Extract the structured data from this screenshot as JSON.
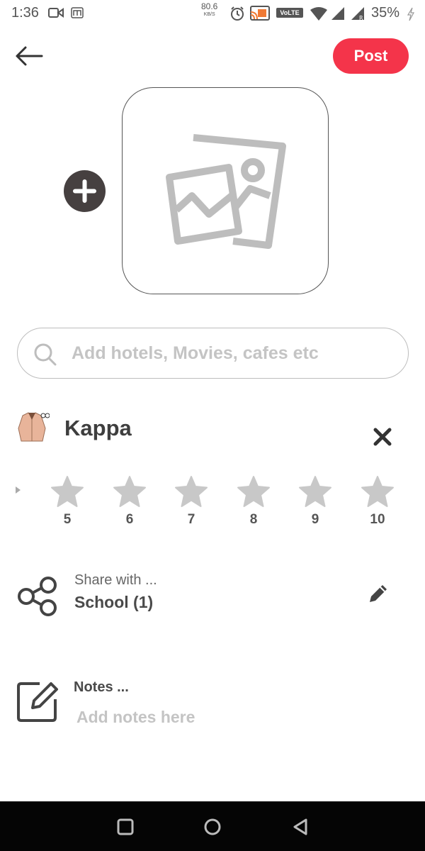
{
  "status_bar": {
    "time": "1:36",
    "net_speed": "80.6",
    "net_speed_unit": "KB/S",
    "volte": "VoLTE",
    "battery": "35%"
  },
  "header": {
    "post_label": "Post",
    "back_icon": "arrow-left-icon"
  },
  "colors": {
    "accent": "#f4344a",
    "dark_button": "#464040",
    "placeholder_gray": "#c4c4c4",
    "star_gray": "#c8c8c8",
    "nav_bar": "#050505"
  },
  "search": {
    "placeholder": "Add hotels, Movies, cafes etc",
    "value": ""
  },
  "selected_item": {
    "name": "Kappa"
  },
  "rating": {
    "options": [
      "5",
      "6",
      "7",
      "8",
      "9",
      "10"
    ]
  },
  "share": {
    "label": "Share with ...",
    "value": "School  (1)"
  },
  "notes": {
    "label": "Notes ...",
    "placeholder": "Add notes here",
    "value": ""
  }
}
